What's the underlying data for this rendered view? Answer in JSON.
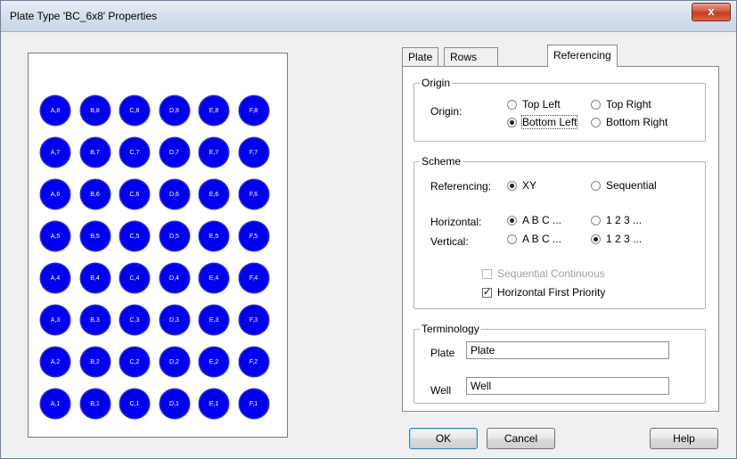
{
  "window": {
    "title": "Plate Type 'BC_6x8' Properties",
    "close_label": "x"
  },
  "plate": {
    "columns": [
      "A",
      "B",
      "C",
      "D",
      "E",
      "F"
    ],
    "rows": [
      "8",
      "7",
      "6",
      "5",
      "4",
      "3",
      "2",
      "1"
    ],
    "well_color": "#0000ee"
  },
  "tabs": [
    {
      "label": "Plate",
      "active": false
    },
    {
      "label": "Rows and Columns",
      "active": false
    },
    {
      "label": "Referencing",
      "active": true
    }
  ],
  "origin": {
    "group_label": "Origin",
    "field_label": "Origin:",
    "options": [
      {
        "label": "Top Left",
        "checked": false
      },
      {
        "label": "Top Right",
        "checked": false
      },
      {
        "label": "Bottom Left",
        "checked": true
      },
      {
        "label": "Bottom Right",
        "checked": false
      }
    ]
  },
  "scheme": {
    "group_label": "Scheme",
    "referencing_label": "Referencing:",
    "referencing_options": [
      {
        "label": "XY",
        "checked": true
      },
      {
        "label": "Sequential",
        "checked": false
      }
    ],
    "horizontal_label": "Horizontal:",
    "horizontal_options": [
      {
        "label": "A B C ...",
        "checked": true
      },
      {
        "label": "1 2 3 ...",
        "checked": false
      }
    ],
    "vertical_label": "Vertical:",
    "vertical_options": [
      {
        "label": "A B C ...",
        "checked": false
      },
      {
        "label": "1 2 3 ...",
        "checked": true
      }
    ],
    "sequential_continuous": {
      "label": "Sequential Continuous",
      "checked": false,
      "enabled": false
    },
    "horizontal_first_priority": {
      "label": "Horizontal First Priority",
      "checked": true,
      "enabled": true
    }
  },
  "terminology": {
    "group_label": "Terminology",
    "plate_label": "Plate",
    "plate_value": "Plate",
    "well_label": "Well",
    "well_value": "Well"
  },
  "buttons": {
    "ok": "OK",
    "cancel": "Cancel",
    "help": "Help"
  }
}
